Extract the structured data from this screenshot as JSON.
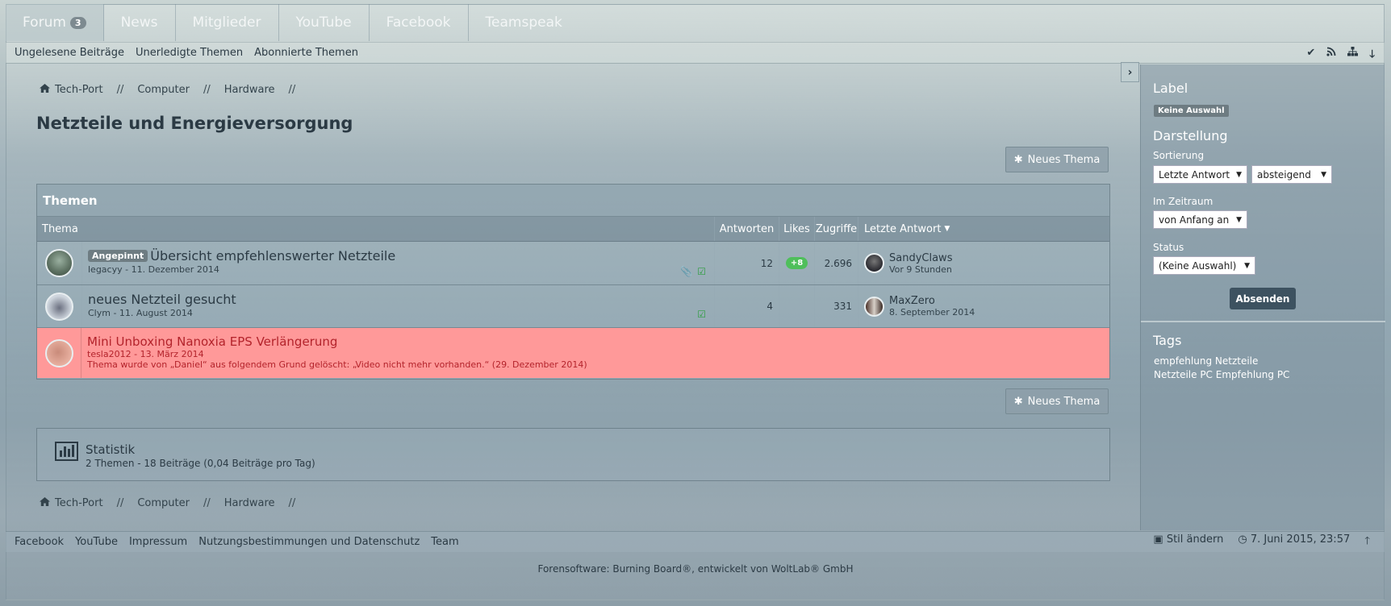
{
  "nav": {
    "tabs": [
      {
        "label": "Forum",
        "count": "3"
      },
      {
        "label": "News"
      },
      {
        "label": "Mitglieder"
      },
      {
        "label": "YouTube"
      },
      {
        "label": "Facebook"
      },
      {
        "label": "Teamspeak"
      }
    ],
    "sub": [
      "Ungelesene Beiträge",
      "Unerledigte Themen",
      "Abonnierte Themen"
    ],
    "icons": [
      "check-icon",
      "rss-icon",
      "sitemap-icon",
      "arrow-down-icon"
    ]
  },
  "breadcrumb": [
    "Tech-Port",
    "Computer",
    "Hardware"
  ],
  "page": {
    "title": "Netzteile und Energieversorgung",
    "new_topic": "Neues Thema"
  },
  "topics": {
    "header": "Themen",
    "columns": {
      "thema": "Thema",
      "antworten": "Antworten",
      "likes": "Likes",
      "zugriffe": "Zugriffe",
      "letzte": "Letzte Antwort"
    },
    "rows": [
      {
        "label": "Angepinnt",
        "title": "Übersicht empfehlenswerter Netzteile",
        "meta": "legacyy - 11. Dezember 2014",
        "replies": "12",
        "likes": "+8",
        "views": "2.696",
        "last_user": "SandyClaws",
        "last_time": "Vor 9 Stunden"
      },
      {
        "title": "neues Netzteil gesucht",
        "meta": "Clym - 11. August 2014",
        "replies": "4",
        "likes": "",
        "views": "331",
        "last_user": "MaxZero",
        "last_time": "8. September 2014"
      },
      {
        "title": "Mini Unboxing Nanoxia EPS Verlängerung",
        "meta": "tesla2012 - 13. März 2014",
        "deleted_note": "Thema wurde von „Daniel“ aus folgendem Grund gelöscht: „Video nicht mehr vorhanden.“ (29. Dezember 2014)"
      }
    ]
  },
  "stats": {
    "title": "Statistik",
    "detail": "2 Themen - 18 Beiträge (0,04 Beiträge pro Tag)"
  },
  "sidebar": {
    "label_heading": "Label",
    "label_value": "Keine Auswahl",
    "display_heading": "Darstellung",
    "sort_label": "Sortierung",
    "sort_field": "Letzte Antwort",
    "sort_order": "absteigend",
    "period_label": "Im Zeitraum",
    "period_value": "von Anfang an",
    "status_label": "Status",
    "status_value": "(Keine Auswahl)",
    "submit": "Absenden",
    "tags_heading": "Tags",
    "tags": [
      "empfehlung Netzteile",
      "Netzteile PC Empfehlung PC"
    ]
  },
  "footer": {
    "links": [
      "Facebook",
      "YouTube",
      "Impressum",
      "Nutzungsbestimmungen und Datenschutz",
      "Team"
    ],
    "style": "Stil ändern",
    "datetime": "7. Juni 2015, 23:57",
    "copyright": "Forensoftware: Burning Board®, entwickelt von WoltLab® GmbH"
  },
  "colors": {
    "deleted_row": "#ff9999",
    "like_badge": "#4fbf5b",
    "submit_button": "#3d5260"
  }
}
